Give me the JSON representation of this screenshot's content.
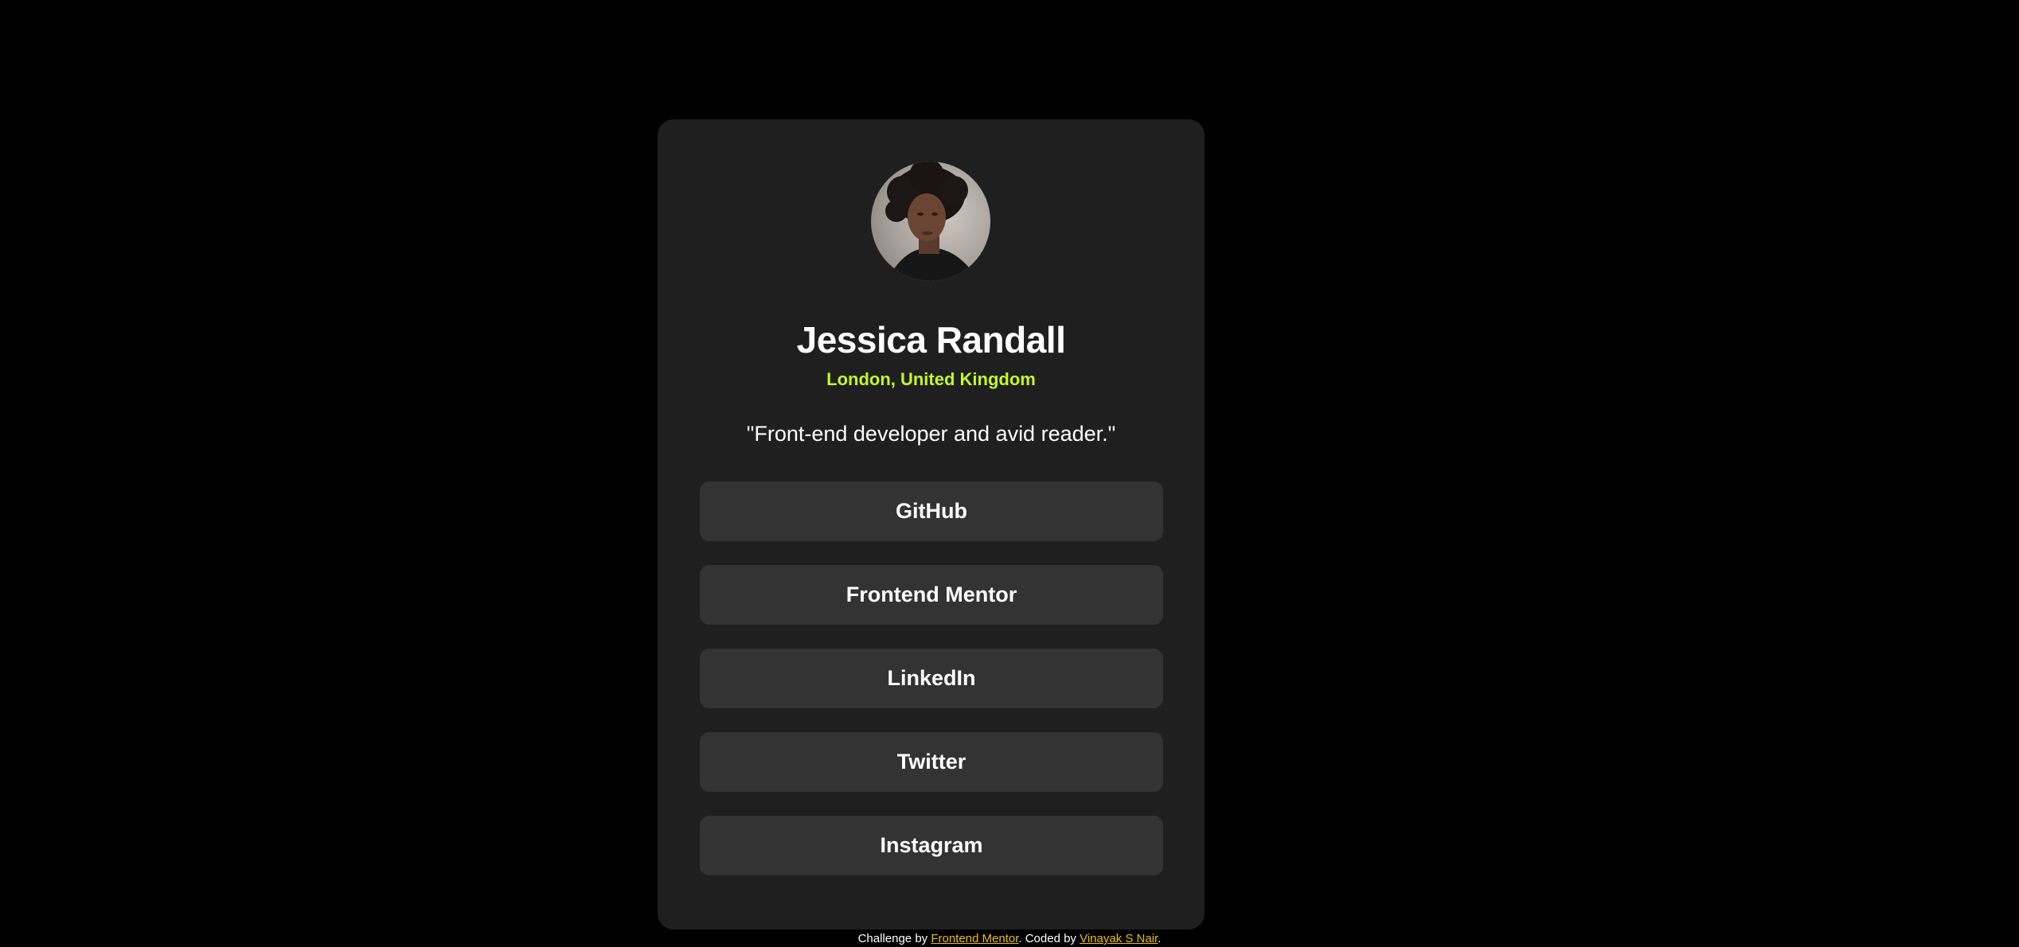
{
  "profile": {
    "name": "Jessica Randall",
    "location": "London, United Kingdom",
    "bio": "\"Front-end developer and avid reader.\""
  },
  "links": [
    {
      "label": "GitHub"
    },
    {
      "label": "Frontend Mentor"
    },
    {
      "label": "LinkedIn"
    },
    {
      "label": "Twitter"
    },
    {
      "label": "Instagram"
    }
  ],
  "attribution": {
    "prefix": "Challenge by ",
    "challenge_link": "Frontend Mentor",
    "middle": ". Coded by ",
    "author_link": "Vinayak S Nair",
    "suffix": "."
  },
  "colors": {
    "background": "#000000",
    "card": "#1f1f1f",
    "button": "#333333",
    "accent": "#c4f82a",
    "attribution_link": "#e6c000",
    "text": "#ffffff"
  }
}
